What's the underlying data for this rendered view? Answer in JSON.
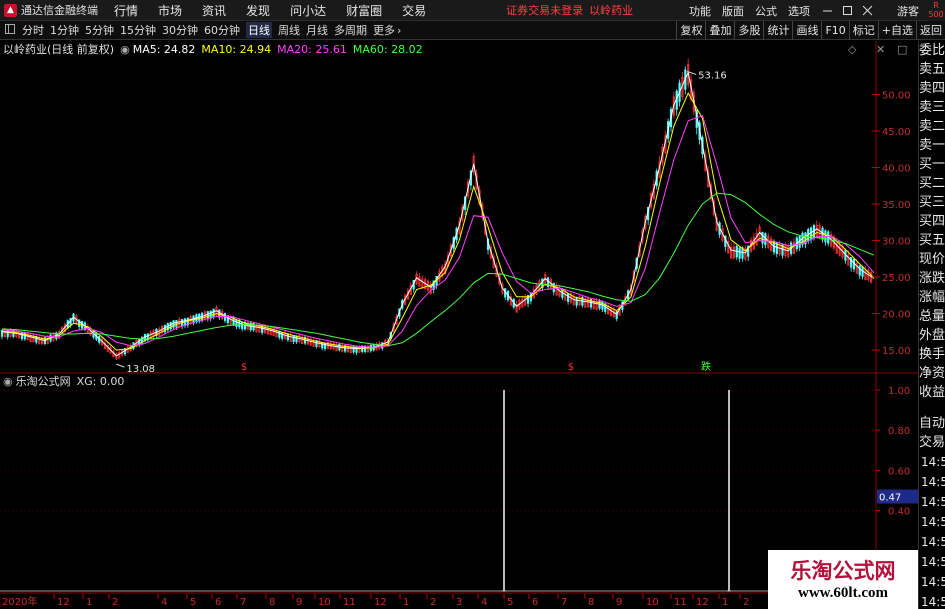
{
  "menubar": {
    "app_title": "通达信金融终端",
    "items": [
      "行情",
      "市场",
      "资讯",
      "发现",
      "问小达",
      "财富圈",
      "交易"
    ],
    "notice": "证券交易未登录",
    "notice_stock": "以岭药业",
    "right_items": [
      "功能",
      "版面",
      "公式",
      "选项"
    ],
    "guest": "游客",
    "r_badge_top": "R",
    "r_badge_bottom": "500"
  },
  "toolbar": {
    "periods": [
      "分时",
      "1分钟",
      "5分钟",
      "15分钟",
      "30分钟",
      "60分钟",
      "日线",
      "周线",
      "月线",
      "多周期",
      "更多"
    ],
    "active_period": "日线",
    "right_buttons": [
      "复权",
      "叠加",
      "多股",
      "统计",
      "画线",
      "F10",
      "标记",
      "+自选",
      "返回"
    ]
  },
  "chart_header": {
    "stock_label": "以岭药业(日线 前复权)",
    "ma5": "MA5: 24.82",
    "ma10": "MA10: 24.94",
    "ma20": "MA20: 25.61",
    "ma60": "MA60: 28.02",
    "colors": {
      "ma5": "#ffffff",
      "ma10": "#ffff00",
      "ma20": "#ff40ff",
      "ma60": "#40ff40"
    }
  },
  "indicator_header": {
    "label": "乐淘公式网",
    "xg": "XG: 0.00"
  },
  "sidebar": {
    "items": [
      "委比",
      "卖五",
      "卖四",
      "卖三",
      "卖二",
      "卖一",
      "买一",
      "买二",
      "买三",
      "买四",
      "买五",
      "现价",
      "涨跌",
      "涨幅",
      "总量",
      "外盘",
      "换手",
      "净资",
      "收益"
    ],
    "auto_trade": [
      "自动",
      "交易"
    ],
    "times": [
      "14:56",
      "14:56",
      "14:56",
      "14:56",
      "14:56",
      "14:56",
      "14:56",
      "14:56"
    ]
  },
  "watermark": {
    "title": "乐淘公式网",
    "url": "www.60lt.com"
  },
  "chart_data": [
    {
      "type": "line",
      "title": "",
      "y_ticks": [
        "50.00",
        "45.00",
        "40.00",
        "35.00",
        "30.00",
        "25.00",
        "20.00",
        "15.00"
      ],
      "ylim": [
        12,
        55
      ],
      "annotations": {
        "high": "53.16",
        "low": "13.08"
      },
      "signal_marks": [
        "$",
        "$",
        "跌"
      ],
      "x_axis_labels": [
        "2020年",
        "12",
        "1",
        "2",
        "4",
        "5",
        "6",
        "7",
        "8",
        "9",
        "10",
        "11",
        "12",
        "1",
        "2",
        "3",
        "4",
        "5",
        "6",
        "7",
        "8",
        "9",
        "10",
        "11",
        "12",
        "1",
        "2"
      ],
      "series": [
        {
          "name": "MA5",
          "color": "#ffffff",
          "values": [
            17.5,
            17.3,
            16.8,
            16.3,
            17.2,
            19.5,
            18.0,
            16.2,
            14.2,
            15.4,
            16.8,
            17.6,
            18.7,
            19.1,
            19.6,
            20.4,
            19.2,
            18.4,
            18.1,
            17.6,
            16.9,
            16.5,
            16.0,
            15.6,
            15.3,
            15.2,
            15.4,
            16.1,
            21.3,
            24.9,
            23.6,
            26.4,
            32.1,
            40.5,
            29.8,
            23.5,
            21.0,
            22.5,
            24.8,
            23.1,
            21.9,
            21.6,
            21.2,
            19.9,
            23.3,
            32.5,
            40.1,
            48.6,
            53.0,
            43.1,
            32.5,
            28.7,
            28.3,
            31.1,
            29.2,
            28.6,
            30.3,
            31.6,
            30.2,
            28.1,
            26.1,
            24.8
          ]
        },
        {
          "name": "MA10",
          "color": "#ffff00",
          "values": [
            17.6,
            17.4,
            17.0,
            16.5,
            17.0,
            18.7,
            18.2,
            16.8,
            15.0,
            15.2,
            16.3,
            17.3,
            18.4,
            19.0,
            19.4,
            20.0,
            19.5,
            18.7,
            18.3,
            17.8,
            17.2,
            16.7,
            16.2,
            15.8,
            15.5,
            15.3,
            15.3,
            15.8,
            19.4,
            23.3,
            23.9,
            25.6,
            30.1,
            37.4,
            31.9,
            25.6,
            22.3,
            22.3,
            24.0,
            23.5,
            22.3,
            21.8,
            21.4,
            20.4,
            22.3,
            29.2,
            37.8,
            45.7,
            50.2,
            46.7,
            36.3,
            30.1,
            28.6,
            30.3,
            29.7,
            28.9,
            29.8,
            31.1,
            30.6,
            28.8,
            26.8,
            24.9
          ]
        },
        {
          "name": "MA20",
          "color": "#ff40ff",
          "values": [
            17.8,
            17.6,
            17.3,
            16.9,
            16.8,
            17.6,
            18.0,
            17.4,
            16.1,
            15.6,
            15.9,
            16.8,
            17.8,
            18.6,
            19.1,
            19.6,
            19.6,
            19.1,
            18.6,
            18.1,
            17.6,
            17.1,
            16.6,
            16.2,
            15.8,
            15.5,
            15.4,
            15.6,
            17.6,
            21.1,
            23.2,
            24.6,
            27.7,
            33.4,
            33.2,
            28.3,
            24.4,
            22.8,
            23.3,
            23.5,
            22.9,
            22.2,
            21.7,
            21.0,
            21.5,
            26.2,
            33.8,
            41.1,
            46.4,
            47.1,
            40.4,
            33.1,
            29.7,
            30.0,
            29.9,
            29.3,
            29.6,
            30.5,
            30.6,
            29.5,
            27.8,
            25.6
          ]
        },
        {
          "name": "MA60",
          "color": "#40ff40",
          "values": [
            17.9,
            17.8,
            17.6,
            17.4,
            17.2,
            17.2,
            17.3,
            17.2,
            16.9,
            16.6,
            16.5,
            16.6,
            16.9,
            17.3,
            17.7,
            18.1,
            18.4,
            18.5,
            18.4,
            18.2,
            17.9,
            17.6,
            17.3,
            16.9,
            16.5,
            16.1,
            15.8,
            15.6,
            16.0,
            17.3,
            18.9,
            20.4,
            22.1,
            24.2,
            25.5,
            25.4,
            24.8,
            24.2,
            23.9,
            23.8,
            23.4,
            23.0,
            22.4,
            21.9,
            21.7,
            22.6,
            24.9,
            28.3,
            32.1,
            35.0,
            36.5,
            36.3,
            35.2,
            33.6,
            32.2,
            31.2,
            30.6,
            30.4,
            30.1,
            29.6,
            28.8,
            28.0
          ]
        }
      ]
    },
    {
      "type": "bar",
      "title": "",
      "y_ticks": [
        "1.00",
        "0.80",
        "0.60",
        "0.40"
      ],
      "current_value_marker": "0.47",
      "ylim": [
        0,
        1
      ],
      "spikes": [
        {
          "value": 1.0
        },
        {
          "value": 1.0
        }
      ]
    }
  ]
}
